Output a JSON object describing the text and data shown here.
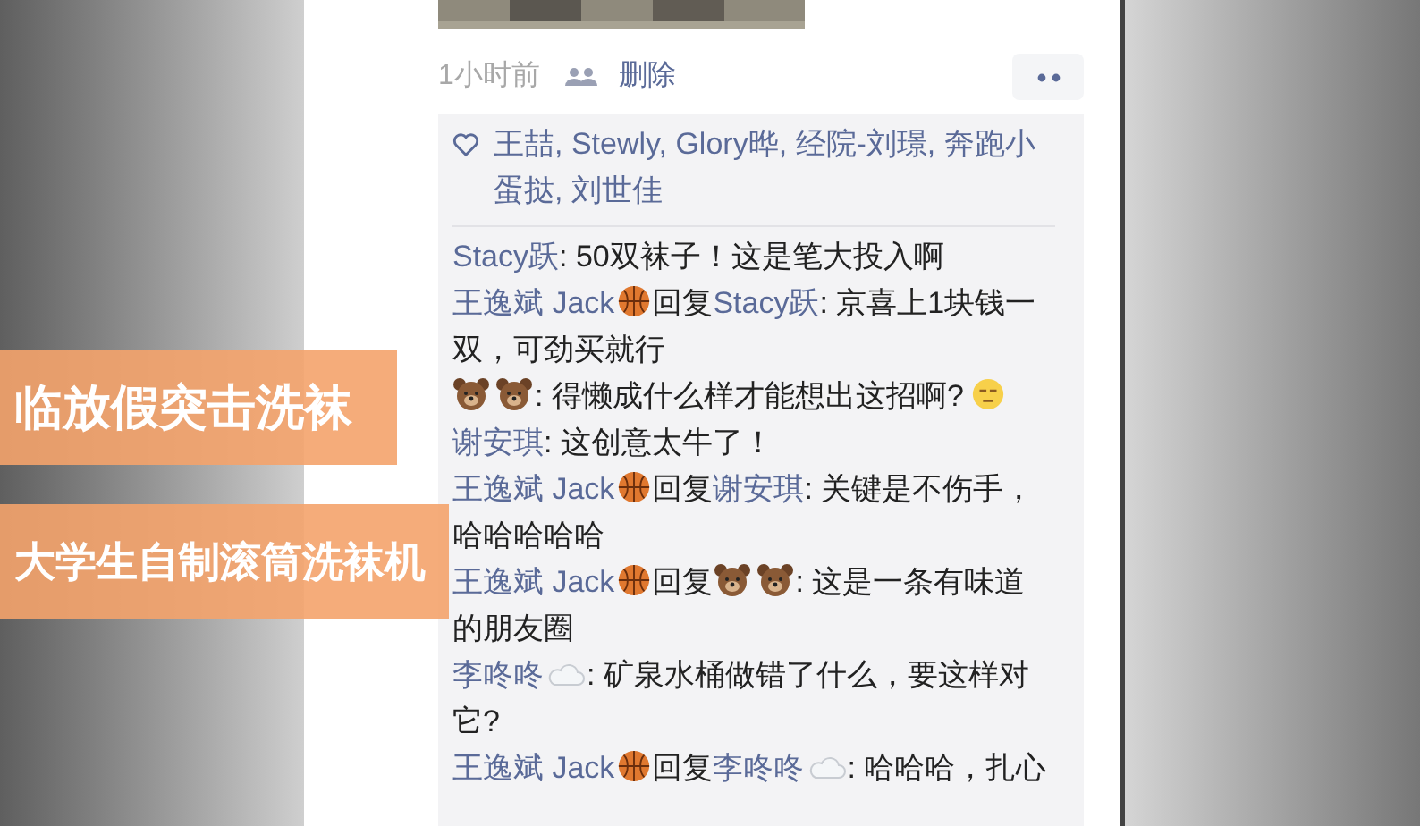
{
  "post": {
    "time": "1小时前",
    "delete": "删除"
  },
  "likes": {
    "names": "王喆, Stewly, Glory晔, 经院-刘璟, 奔跑小蛋挞, 刘世佳"
  },
  "comments": [
    {
      "author": {
        "name": "Stacy跃"
      },
      "text": ": 50双袜子！这是笔大投入啊"
    },
    {
      "author": {
        "name": "王逸斌 Jack",
        "kind": "basketball"
      },
      "reply_word": "回复",
      "reply_to": {
        "name": "Stacy跃"
      },
      "text": ": 京喜上1块钱一双，可劲买就行"
    },
    {
      "author": {
        "kind": "bears"
      },
      "text": ": 得懒成什么样才能想出这招啊?",
      "trailing": {
        "kind": "face"
      }
    },
    {
      "author": {
        "name": "谢安琪"
      },
      "text": ": 这创意太牛了！"
    },
    {
      "author": {
        "name": "王逸斌 Jack",
        "kind": "basketball"
      },
      "reply_word": "回复",
      "reply_to": {
        "name": "谢安琪"
      },
      "text": ": 关键是不伤手，哈哈哈哈哈"
    },
    {
      "author": {
        "name": "王逸斌 Jack",
        "kind": "basketball"
      },
      "reply_word": "回复",
      "reply_to": {
        "kind": "bears"
      },
      "text": ": 这是一条有味道的朋友圈"
    },
    {
      "author": {
        "name": "李咚咚",
        "kind": "cloud"
      },
      "text": ": 矿泉水桶做错了什么，要这样对它?"
    },
    {
      "author": {
        "name": "王逸斌 Jack",
        "kind": "basketball"
      },
      "reply_word": "回复",
      "reply_to": {
        "name": "李咚咚",
        "kind": "cloud"
      },
      "text": ": 哈哈哈，扎心"
    }
  ],
  "captions": [
    "临放假突击洗袜",
    "大学生自制滚筒洗袜机"
  ]
}
